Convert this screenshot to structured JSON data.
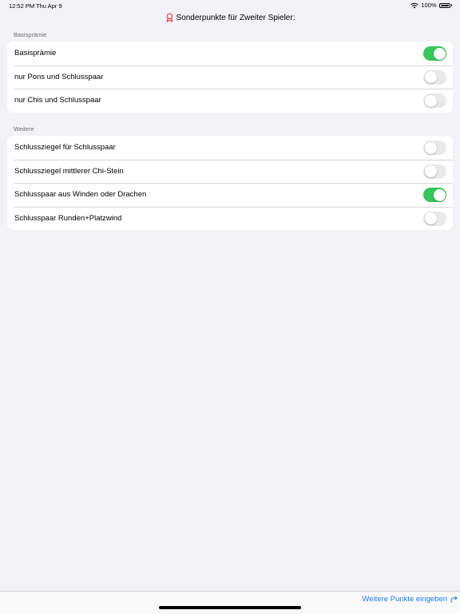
{
  "status_bar": {
    "time": "12:52 PM",
    "date": "Thu Apr 9",
    "battery": "100%"
  },
  "nav": {
    "title": "Sonderpunkte für Zweiter Spieler:",
    "icon": "award-icon",
    "icon_color": "#e53935"
  },
  "sections": [
    {
      "header": "Basisprämie",
      "rows": [
        {
          "label": "Basisprämie",
          "on": true
        },
        {
          "label": "nur Pons und Schlusspaar",
          "on": false
        },
        {
          "label": "nur Chis und Schlusspaar",
          "on": false
        }
      ]
    },
    {
      "header": "Weitere",
      "rows": [
        {
          "label": "Schlussziegel für Schlusspaar",
          "on": false
        },
        {
          "label": "Schlussziegel mittlerer Chi-Stein",
          "on": false
        },
        {
          "label": "Schlusspaar aus Winden oder Drachen",
          "on": true
        },
        {
          "label": "Schlusspaar Runden+Platzwind",
          "on": false
        }
      ]
    }
  ],
  "bottom_bar": {
    "link": "Weitere Punkte eingeben",
    "link_icon": "arrow-forward-icon",
    "link_color": "#1a7cf5"
  },
  "colors": {
    "toggle_on": "#34c759",
    "toggle_off": "#e9e9ea",
    "background": "#f2f2f7"
  }
}
